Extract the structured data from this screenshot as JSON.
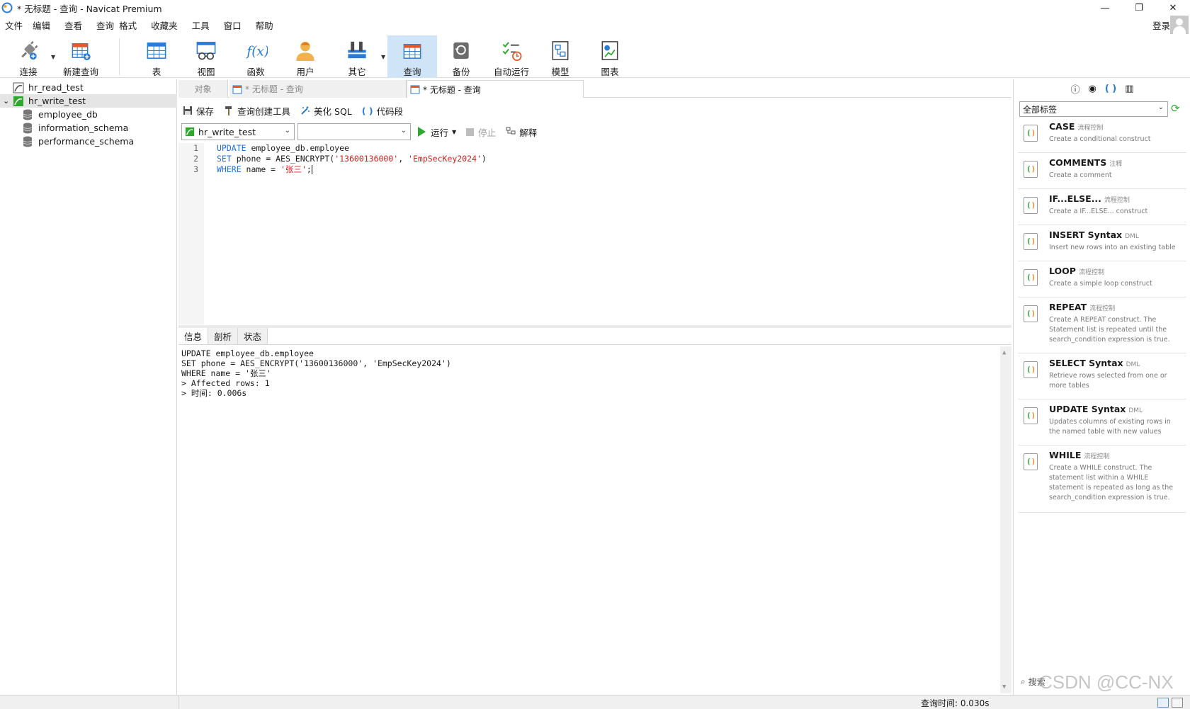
{
  "window": {
    "title": "* 无标题 - 查询 - Navicat Premium"
  },
  "menu": [
    "文件",
    "编辑",
    "查看",
    "查询",
    "格式",
    "收藏夹",
    "工具",
    "窗口",
    "帮助"
  ],
  "account": {
    "login": "登录"
  },
  "toolbar": {
    "connect": "连接",
    "new_query": "新建查询",
    "table": "表",
    "view": "视图",
    "function": "函数",
    "user": "用户",
    "others": "其它",
    "query": "查询",
    "backup": "备份",
    "automation": "自动运行",
    "model": "模型",
    "chart": "图表"
  },
  "navigator": {
    "connections": [
      {
        "name": "hr_read_test",
        "expanded": false
      },
      {
        "name": "hr_write_test",
        "expanded": true,
        "selected": true,
        "databases": [
          "employee_db",
          "information_schema",
          "performance_schema"
        ]
      }
    ]
  },
  "tabs": {
    "objects": "对象",
    "tab1": "* 无标题 - 查询",
    "tab2": "* 无标题 - 查询"
  },
  "query_toolbar": {
    "save": "保存",
    "query_builder": "查询创建工具",
    "beautify": "美化 SQL",
    "snippet": "代码段",
    "connection": "hr_write_test",
    "database": "",
    "run": "运行",
    "stop": "停止",
    "explain": "解释"
  },
  "editor": {
    "line_numbers": [
      "1",
      "2",
      "3"
    ],
    "l1_kw": "UPDATE",
    "l1_rest": " employee_db.employee",
    "l2_kw": "SET",
    "l2_a": " phone = AES_ENCRYPT(",
    "l2_s1": "'13600136000'",
    "l2_b": ", ",
    "l2_s2": "'EmpSecKey2024'",
    "l2_c": ")",
    "l3_kw": "WHERE",
    "l3_a": " name = ",
    "l3_s": "'张三'",
    "l3_b": ";"
  },
  "result_tabs": [
    "信息",
    "剖析",
    "状态"
  ],
  "result_messages": [
    "UPDATE employee_db.employee",
    "SET phone = AES_ENCRYPT('13600136000', 'EmpSecKey2024')",
    "WHERE name = '张三'",
    "> Affected rows: 1",
    "> 时间: 0.006s"
  ],
  "snippets_panel": {
    "tag_filter": "全部标签",
    "items": [
      {
        "name": "CASE",
        "tag": "流程控制",
        "desc": "Create a conditional construct"
      },
      {
        "name": "COMMENTS",
        "tag": "注释",
        "desc": "Create a comment"
      },
      {
        "name": "IF...ELSE...",
        "tag": "流程控制",
        "desc": "Create a IF...ELSE... construct"
      },
      {
        "name": "INSERT Syntax",
        "tag": "DML",
        "desc": "Insert new rows into an existing table"
      },
      {
        "name": "LOOP",
        "tag": "流程控制",
        "desc": "Create a simple loop construct"
      },
      {
        "name": "REPEAT",
        "tag": "流程控制",
        "desc": "Create A REPEAT construct. The Statement list is repeated until the search_condition expression is true."
      },
      {
        "name": "SELECT Syntax",
        "tag": "DML",
        "desc": "Retrieve rows selected from one or more tables"
      },
      {
        "name": "UPDATE Syntax",
        "tag": "DML",
        "desc": "Updates columns of existing rows in the named table with new values"
      },
      {
        "name": "WHILE",
        "tag": "流程控制",
        "desc": "Create a WHILE construct. The statement list within a WHILE statement is repeated as long as the search_condition expression is true."
      }
    ],
    "search": "搜索"
  },
  "watermark": "CSDN @CC-NX",
  "status": {
    "query_time": "查询时间: 0.030s"
  },
  "colors": {
    "accent_active": "#cfe4f6",
    "keyword": "#1e6fd6",
    "string": "#d81b1b",
    "run_green": "#2ea82e"
  }
}
